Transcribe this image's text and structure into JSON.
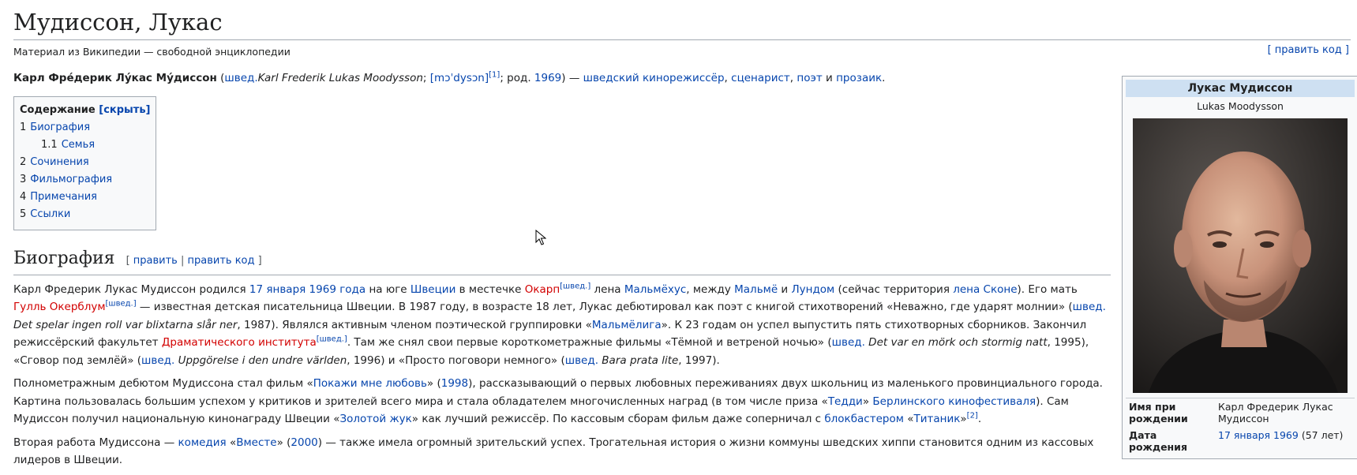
{
  "page": {
    "title": "Мудиссон, Лукас",
    "tagline": "Материал из Википедии — свободной энциклопедии",
    "edit_code_top": "[ править код ]"
  },
  "lead": {
    "name_bold": "Карл Фре́дерик Лу́кас Му́диссон",
    "open": " (",
    "lang": "швед.",
    "orig_name": "Karl Frederik Lukas Moodysson",
    "semi": "; ",
    "ipa": "[mɔˈdysɔn]",
    "ref1": "[1]",
    "born": "; род. ",
    "year": "1969",
    "close": ") — ",
    "occ1": "шведский кинорежиссёр",
    "c1": ", ",
    "occ2": "сценарист",
    "c2": ", ",
    "occ3": "поэт",
    "and": " и ",
    "occ4": "прозаик",
    "end": "."
  },
  "toc": {
    "title": "Содержание",
    "toggle": "[скрыть]",
    "items": [
      {
        "num": "1",
        "label": "Биография"
      },
      {
        "num": "1.1",
        "label": "Семья"
      },
      {
        "num": "2",
        "label": "Сочинения"
      },
      {
        "num": "3",
        "label": "Фильмография"
      },
      {
        "num": "4",
        "label": "Примечания"
      },
      {
        "num": "5",
        "label": "Ссылки"
      }
    ]
  },
  "bio": {
    "heading": "Биография",
    "edit_open": "[ ",
    "edit": "править",
    "sep": " | ",
    "edit_code": "править код",
    "edit_close": " ]",
    "p1": {
      "t1": "Карл Фредерик Лукас Мудиссон родился ",
      "l1": "17 января 1969 года",
      "t2": " на юге ",
      "l2": "Швеции",
      "t3": " в местечке ",
      "r1": "Окарп",
      "s1": "[швед.]",
      "t4": " лена ",
      "l3": "Мальмёхус",
      "t5": ", между ",
      "l4": "Мальмё",
      "t6": " и ",
      "l5": "Лундом",
      "t7": " (сейчас территория ",
      "l6": "лена Сконе",
      "t8": "). Его мать ",
      "r2": "Гулль Окерблум",
      "s2": "[швед.]",
      "t9": " — известная детская писательница Швеции. В 1987 году, в возрасте 18 лет, Лукас дебютировал как поэт с книгой стихотворений «Неважно, где ударят молнии» (",
      "l7": "швед.",
      "i1": " Det spelar ingen roll var blixtarna slår ner",
      "t10": ", 1987). Являлся активным членом поэтической группировки «",
      "l8": "Мальмёлига",
      "t11": "». К 23 годам он успел выпустить пять стихотворных сборников. Закончил режиссёрский факультет ",
      "r3": "Драматического института",
      "s3": "[швед.]",
      "t12": ". Там же снял свои первые короткометражные фильмы «Тёмной и ветреной ночью» (",
      "l9": "швед.",
      "i2": " Det var en mörk och stormig natt",
      "t13": ", 1995), «Сговор под землёй» (",
      "l10": "швед.",
      "i3": " Uppgörelse i den undre världen",
      "t14": ", 1996) и «Просто поговори немного» (",
      "l11": "швед.",
      "i4": " Bara prata lite",
      "t15": ", 1997)."
    },
    "p2": {
      "t1": "Полнометражным дебютом Мудиссона стал фильм «",
      "l1": "Покажи мне любовь",
      "t2": "» (",
      "l2": "1998",
      "t3": "), рассказывающий о первых любовных переживаниях двух школьниц из маленького провинциального города. Картина пользовалась большим успехом у критиков и зрителей всего мира и стала обладателем многочисленных наград (в том числе приза «",
      "l3": "Тедди",
      "t4": "» ",
      "l4": "Берлинского кинофестиваля",
      "t5": "). Сам Мудиссон получил национальную кинонаграду Швеции «",
      "l5": "Золотой жук",
      "t6": "» как лучший режиссёр. По кассовым сборам фильм даже соперничал с ",
      "l6": "блокбастером",
      "t7": " «",
      "l7": "Титаник",
      "t8": "»",
      "s1": "[2]",
      "t9": "."
    },
    "p3": {
      "t1": "Вторая работа Мудиссона — ",
      "l1": "комедия",
      "t2": " «",
      "l2": "Вместе",
      "t3": "» (",
      "l3": "2000",
      "t4": ") — также имела огромный зрительский успех. Трогательная история о жизни коммуны шведских хиппи становится одним из кассовых лидеров в Швеции."
    }
  },
  "infobox": {
    "name": "Лукас Мудиссон",
    "orig": "Lukas Moodysson",
    "rows": [
      {
        "label": "Имя при рождении",
        "value": "Карл Фредерик Лукас Мудиссон"
      },
      {
        "label": "Дата рождения",
        "value_link": "17 января 1969",
        "value_after": " (57 лет)"
      }
    ]
  },
  "colors": {
    "link": "#0645ad",
    "redlink": "#d20000",
    "infobox_header": "#cee0f2",
    "border": "#a2a9b1"
  },
  "icons": {
    "cursor": "mouse-pointer-icon"
  }
}
